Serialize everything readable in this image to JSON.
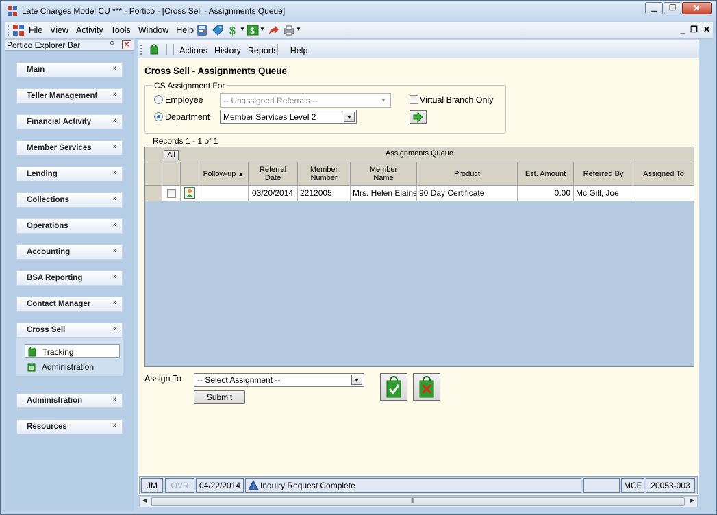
{
  "window": {
    "title": "Late Charges Model CU *** - Portico - [Cross Sell - Assignments Queue]",
    "minimize_glyph": "▁",
    "restore_glyph": "❐",
    "close_glyph": "✕"
  },
  "menubar": {
    "items": [
      "File",
      "View",
      "Activity",
      "Tools",
      "Window",
      "Help"
    ],
    "mdi_min": "_",
    "mdi_restore": "❐",
    "mdi_close": "✕"
  },
  "explorer": {
    "title": "Portico Explorer Bar",
    "pin_glyph": "⚲",
    "close_glyph": "✕",
    "groups": [
      {
        "label": "Main",
        "chev": "»"
      },
      {
        "label": "Teller Management",
        "chev": "»"
      },
      {
        "label": "Financial Activity",
        "chev": "»"
      },
      {
        "label": "Member Services",
        "chev": "»"
      },
      {
        "label": "Lending",
        "chev": "»"
      },
      {
        "label": "Collections",
        "chev": "»"
      },
      {
        "label": "Operations",
        "chev": "»"
      },
      {
        "label": "Accounting",
        "chev": "»"
      },
      {
        "label": "BSA Reporting",
        "chev": "»"
      },
      {
        "label": "Contact Manager",
        "chev": "»"
      },
      {
        "label": "Cross Sell",
        "chev": "«"
      },
      {
        "label": "Administration",
        "chev": "»"
      },
      {
        "label": "Resources",
        "chev": "»"
      }
    ],
    "cross_sell_items": [
      "Tracking",
      "Administration"
    ]
  },
  "toolbar": {
    "items": [
      "Actions",
      "History",
      "Reports",
      "Help"
    ]
  },
  "page": {
    "title": "Cross Sell - Assignments Queue",
    "cs_group_label": "CS Assignment For",
    "employee_label": "Employee",
    "employee_value": "-- Unassigned Referrals --",
    "department_label": "Department",
    "department_value": "Member Services Level 2",
    "virtual_branch_label": "Virtual Branch Only",
    "go_glyph": "➔",
    "records_label": "Records 1 - 1 of 1"
  },
  "grid": {
    "caption": "Assignments Queue",
    "all_button": "All",
    "columns": [
      "Follow-up",
      "Referral Date",
      "Member Number",
      "Member Name",
      "Product",
      "Est. Amount",
      "Referred By",
      "Assigned To"
    ],
    "sort_glyph": "▲",
    "rows": [
      {
        "follow_up": "",
        "referral_date": "03/20/2014",
        "member_number": "2212005",
        "member_name": "Mrs. Helen Elaine",
        "product": "90 Day Certificate",
        "est_amount": "0.00",
        "referred_by": "Mc Gill, Joe",
        "assigned_to": ""
      }
    ]
  },
  "assign": {
    "label": "Assign To",
    "select_value": "-- Select Assignment --",
    "submit_label": "Submit"
  },
  "statusbar": {
    "user": "JM",
    "ovr": "OVR",
    "date": "04/22/2014",
    "message": "Inquiry Request Complete",
    "empty": "",
    "branch": "MCF",
    "code": "20053-003"
  },
  "scroll": {
    "left": "◀",
    "right": "▶",
    "grip": "|||"
  },
  "colors": {
    "accent_green": "#2f9e2f",
    "title_bar": "#c3d8ee",
    "content_bg": "#fefbea",
    "grid_bg": "#b5c9df"
  }
}
